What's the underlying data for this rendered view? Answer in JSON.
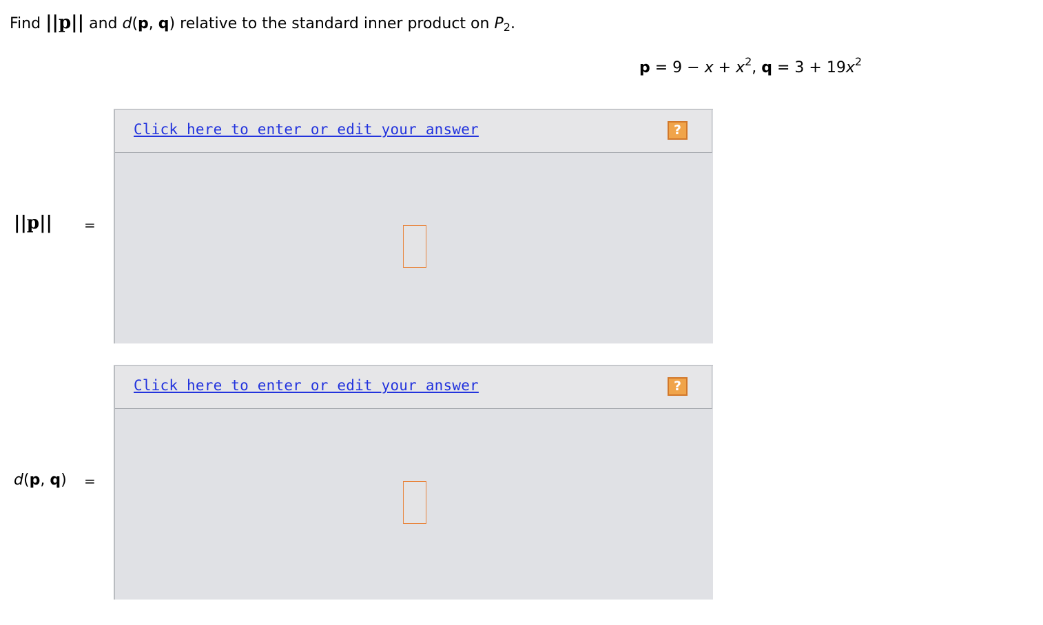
{
  "question": {
    "find_word": "Find",
    "norm_symbol": "||p||",
    "and_word": "and",
    "dist_d": "d",
    "dist_open": "(",
    "dist_p": "p",
    "dist_comma": ", ",
    "dist_q": "q",
    "dist_close": ")",
    "rest_text": "relative to the standard inner product on",
    "space_name": "P",
    "space_sub": "2",
    "period": "."
  },
  "given": {
    "p_var": "p",
    "p_expr_a": " = 9 − ",
    "p_x": "x",
    "p_expr_b": " + ",
    "p_x2": "x",
    "p_exp": "2",
    "sep": ", ",
    "q_var": "q",
    "q_expr_a": " = 3 + 19",
    "q_x": "x",
    "q_exp": "2"
  },
  "rows": [
    {
      "label_norm": "||p||",
      "equals": "=",
      "link_text": "Click here to enter or edit your answer",
      "help_icon": "?"
    },
    {
      "label_d": "d",
      "label_open": "(",
      "label_p": "p",
      "label_comma": ", ",
      "label_q": "q",
      "label_close": ")",
      "equals": "=",
      "link_text": "Click here to enter or edit your answer",
      "help_icon": "?"
    }
  ],
  "colors": {
    "link": "#2233dd",
    "help_icon_bg": "#f0a44a",
    "panel_bg": "#e0e1e5",
    "input_border": "#e8833a"
  }
}
